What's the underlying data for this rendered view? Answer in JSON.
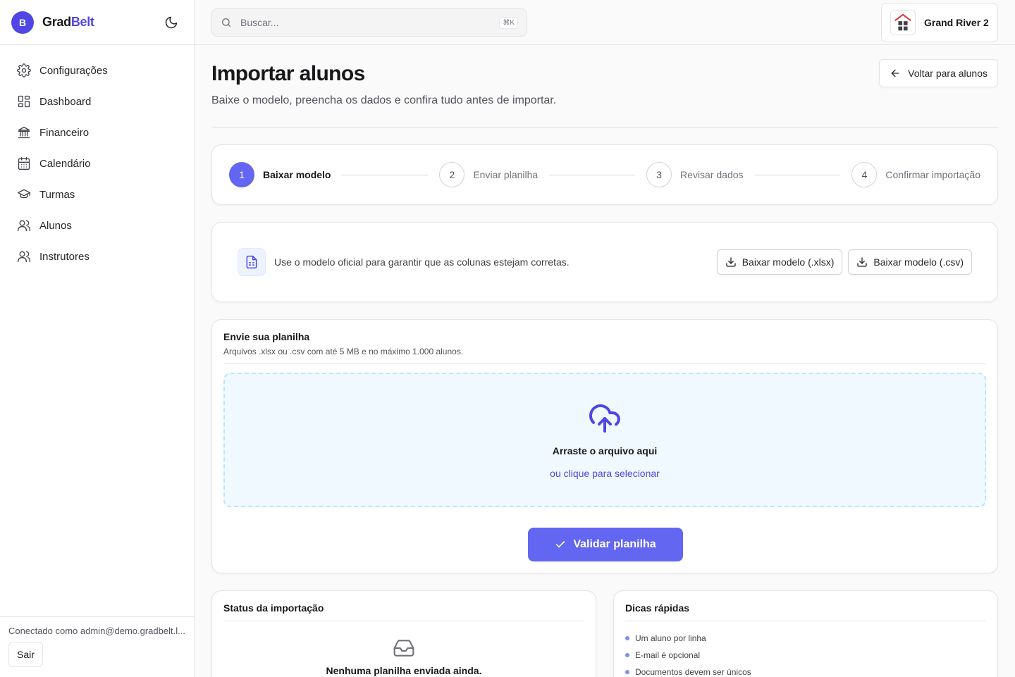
{
  "brand": {
    "initial": "B",
    "name_part1": "Grad",
    "name_part2": "Belt"
  },
  "sidebar": {
    "items": [
      {
        "label": "Configurações",
        "icon": "gear-icon"
      },
      {
        "label": "Dashboard",
        "icon": "layout-grid-icon"
      },
      {
        "label": "Financeiro",
        "icon": "bank-icon"
      },
      {
        "label": "Calendário",
        "icon": "calendar-icon"
      },
      {
        "label": "Turmas",
        "icon": "graduation-cap-icon"
      },
      {
        "label": "Alunos",
        "icon": "users-icon"
      },
      {
        "label": "Instrutores",
        "icon": "users-icon"
      }
    ],
    "connected_as": "Conectado como admin@demo.gradbelt.l...",
    "logout_label": "Sair"
  },
  "topbar": {
    "search_placeholder": "Buscar...",
    "search_shortcut": "⌘K",
    "org_name": "Grand River 2"
  },
  "page": {
    "title": "Importar alunos",
    "subtitle": "Baixe o modelo, preencha os dados e confira tudo antes de importar.",
    "back_label": "Voltar para alunos"
  },
  "stepper": {
    "steps": [
      {
        "number": "1",
        "label": "Baixar modelo",
        "active": true
      },
      {
        "number": "2",
        "label": "Enviar planilha",
        "active": false
      },
      {
        "number": "3",
        "label": "Revisar dados",
        "active": false
      },
      {
        "number": "4",
        "label": "Confirmar importação",
        "active": false
      }
    ]
  },
  "template_card": {
    "text": "Use o modelo oficial para garantir que as colunas estejam corretas.",
    "xlsx_label": "Baixar modelo (.xlsx)",
    "csv_label": "Baixar modelo (.csv)"
  },
  "upload": {
    "title": "Envie sua planilha",
    "description": "Arquivos .xlsx ou .csv com até 5 MB e no máximo 1.000 alunos.",
    "drop_title": "Arraste o arquivo aqui",
    "drop_link": "ou clique para selecionar",
    "validate_label": "Validar planilha"
  },
  "status": {
    "title": "Status da importação",
    "empty_text": "Nenhuma planilha enviada ainda."
  },
  "tips": {
    "title": "Dicas rápidas",
    "items": [
      "Um aluno por linha",
      "E-mail é opcional",
      "Documentos devem ser únicos"
    ]
  },
  "colors": {
    "accent": "#6366f1",
    "brand": "#4f46e5",
    "dropzone_border": "#bae6fd",
    "dropzone_bg": "#f0f9ff"
  }
}
